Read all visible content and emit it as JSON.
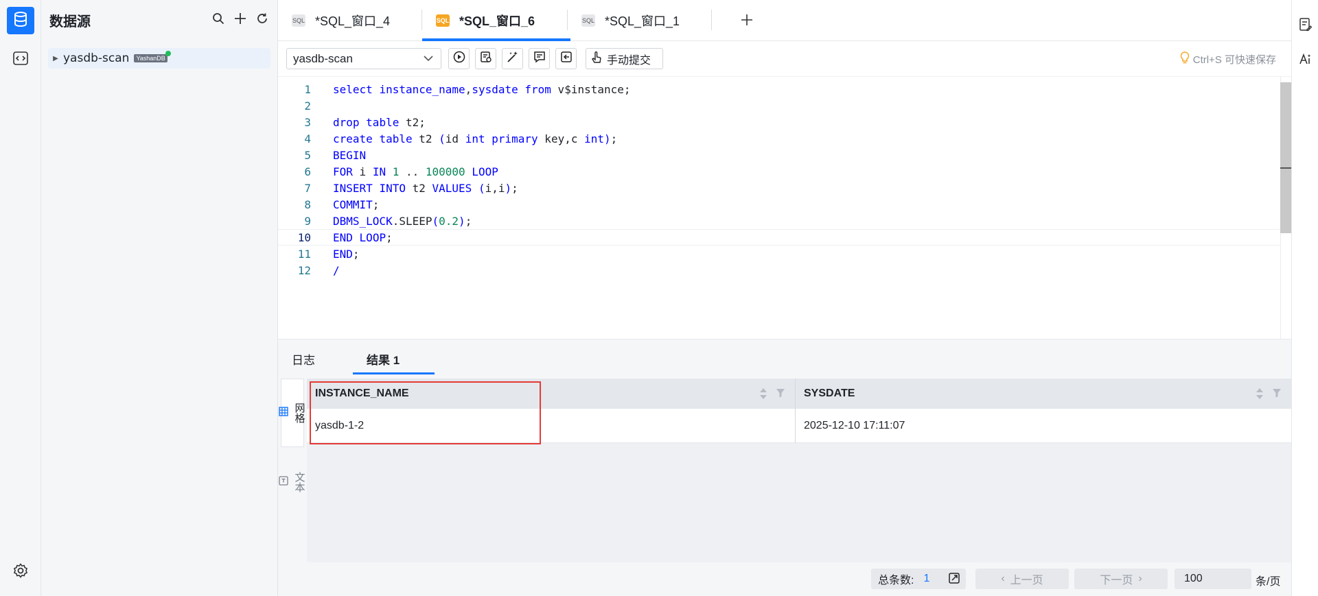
{
  "datasource": {
    "title": "数据源",
    "node_name": "yasdb-scan",
    "node_badge": "YashanDB"
  },
  "tabs": [
    {
      "label": "*SQL_窗口_4",
      "icon": "SQL",
      "active": false
    },
    {
      "label": "*SQL_窗口_6",
      "icon": "SQL",
      "active": true
    },
    {
      "label": "*SQL_窗口_1",
      "icon": "SQL",
      "active": false
    }
  ],
  "toolbar": {
    "connection": "yasdb-scan",
    "manual_commit": "手动提交",
    "save_hint": "Ctrl+S 可快速保存"
  },
  "editor": {
    "current_line": 10,
    "lines": [
      "select instance_name,sysdate from v$instance;",
      "",
      "drop table t2;",
      "create table t2 (id int primary key,c int);",
      "BEGIN",
      "FOR i IN 1 .. 100000 LOOP",
      "INSERT INTO t2 VALUES (i,i);",
      "COMMIT;",
      "DBMS_LOCK.SLEEP(0.2);",
      "END LOOP;",
      "END;",
      "/"
    ],
    "line_numbers": [
      "1",
      "2",
      "3",
      "4",
      "5",
      "6",
      "7",
      "8",
      "9",
      "10",
      "11",
      "12"
    ]
  },
  "result_tabs": {
    "log": "日志",
    "result": "结果 1"
  },
  "view_tabs": {
    "grid": "网格",
    "text": "文本"
  },
  "grid": {
    "columns": [
      "INSTANCE_NAME",
      "SYSDATE"
    ],
    "rows": [
      [
        "yasdb-1-2",
        "2025-12-10 17:11:07"
      ]
    ]
  },
  "pager": {
    "total_label": "总条数:",
    "total_count": "1",
    "prev": "上一页",
    "next": "下一页",
    "page_size": "100",
    "unit": "条/页"
  },
  "colors": {
    "accent": "#1677ff",
    "highlight_box": "#e53935",
    "active_tab_icon": "#f6a623"
  }
}
